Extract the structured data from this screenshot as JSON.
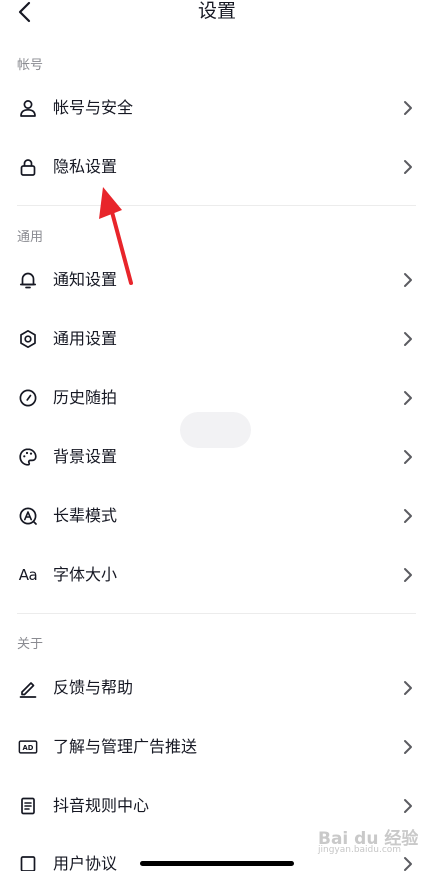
{
  "header": {
    "title": "设置"
  },
  "sections": {
    "account": {
      "label": "帐号",
      "items": [
        {
          "label": "帐号与安全",
          "icon": "user-icon"
        },
        {
          "label": "隐私设置",
          "icon": "lock-icon"
        }
      ]
    },
    "general": {
      "label": "通用",
      "items": [
        {
          "label": "通知设置",
          "icon": "bell-icon"
        },
        {
          "label": "通用设置",
          "icon": "gear-icon"
        },
        {
          "label": "历史随拍",
          "icon": "history-icon"
        },
        {
          "label": "背景设置",
          "icon": "palette-icon"
        },
        {
          "label": "长辈模式",
          "icon": "elder-mode-icon"
        },
        {
          "label": "字体大小",
          "icon": "font-size-icon",
          "glyph": "Aa"
        }
      ]
    },
    "about": {
      "label": "关于",
      "items": [
        {
          "label": "反馈与帮助",
          "icon": "pen-icon"
        },
        {
          "label": "了解与管理广告推送",
          "icon": "ad-icon",
          "glyph": "AD"
        },
        {
          "label": "抖音规则中心",
          "icon": "document-icon"
        },
        {
          "label": "用户协议",
          "icon": "agreement-icon"
        }
      ]
    }
  },
  "watermark": {
    "text": "Bai du 经验",
    "subtext": "jingyan.baidu.com"
  },
  "colors": {
    "text": "#161823",
    "section": "#8a8b91",
    "arrow": "#e8252b",
    "divider": "#ececec"
  }
}
